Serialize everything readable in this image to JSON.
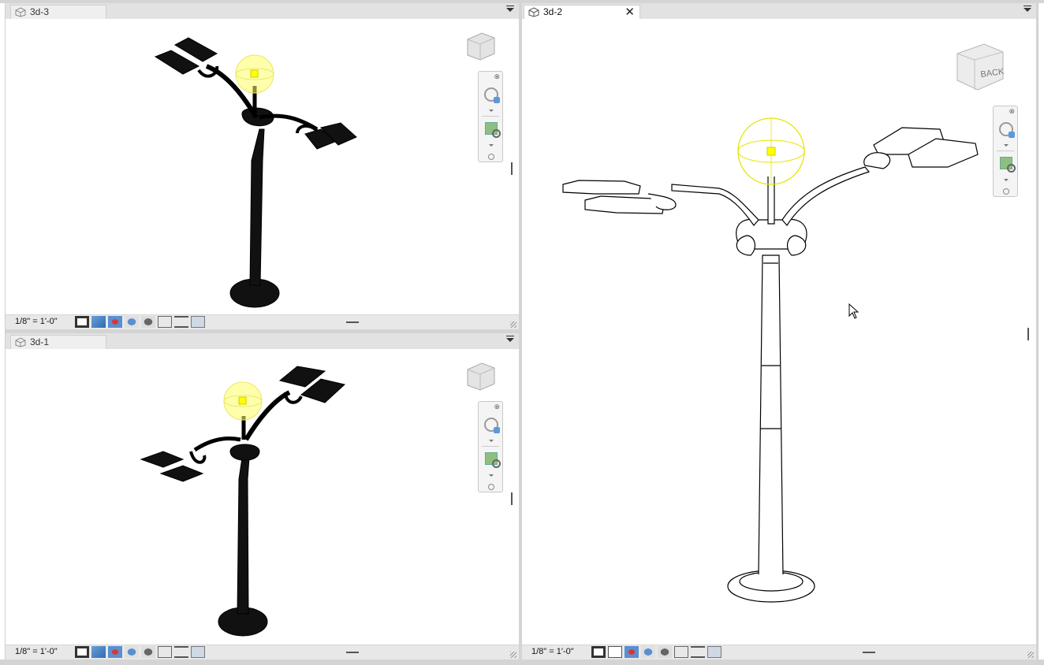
{
  "views": [
    {
      "tab_label": "3d-3",
      "scale": "1/8\" = 1'-0\"",
      "style": "shaded"
    },
    {
      "tab_label": "3d-1",
      "scale": "1/8\" = 1'-0\"",
      "style": "shaded"
    },
    {
      "tab_label": "3d-2",
      "scale": "1/8\" = 1'-0\"",
      "style": "wireframe",
      "viewcube_face": "BACK"
    }
  ],
  "colors": {
    "light_sphere": "#ffff66",
    "light_source": "#ffff00",
    "model_solid": "#111111"
  }
}
